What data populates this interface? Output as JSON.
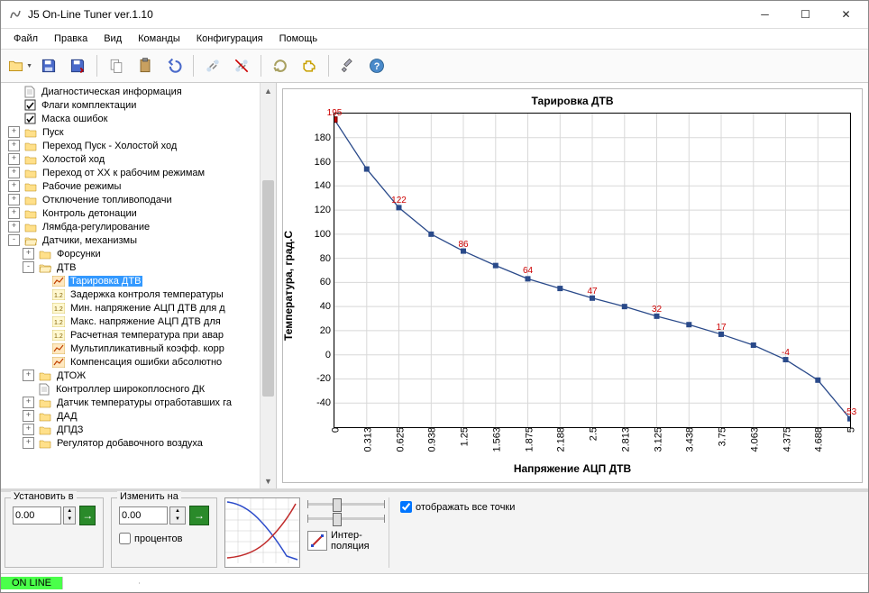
{
  "window": {
    "title": "J5 On-Line Tuner ver.1.10"
  },
  "menu": {
    "file": "Файл",
    "edit": "Правка",
    "view": "Вид",
    "commands": "Команды",
    "config": "Конфигурация",
    "help": "Помощь"
  },
  "tree": {
    "items": [
      {
        "d": 0,
        "exp": "",
        "ic": "page",
        "label": "Диагностическая информация"
      },
      {
        "d": 0,
        "exp": "",
        "ic": "check",
        "label": "Флаги комплектации"
      },
      {
        "d": 0,
        "exp": "",
        "ic": "check",
        "label": "Маска ошибок"
      },
      {
        "d": 0,
        "exp": "+",
        "ic": "folder",
        "label": "Пуск"
      },
      {
        "d": 0,
        "exp": "+",
        "ic": "folder",
        "label": "Переход Пуск - Холостой ход"
      },
      {
        "d": 0,
        "exp": "+",
        "ic": "folder",
        "label": "Холостой ход"
      },
      {
        "d": 0,
        "exp": "+",
        "ic": "folder",
        "label": "Переход от ХХ к рабочим режимам"
      },
      {
        "d": 0,
        "exp": "+",
        "ic": "folder",
        "label": "Рабочие режимы"
      },
      {
        "d": 0,
        "exp": "+",
        "ic": "folder",
        "label": "Отключение топливоподачи"
      },
      {
        "d": 0,
        "exp": "+",
        "ic": "folder",
        "label": "Контроль детонации"
      },
      {
        "d": 0,
        "exp": "+",
        "ic": "folder",
        "label": "Лямбда-регулирование"
      },
      {
        "d": 0,
        "exp": "-",
        "ic": "folderO",
        "label": "Датчики, механизмы"
      },
      {
        "d": 1,
        "exp": "+",
        "ic": "folder",
        "label": "Форсунки"
      },
      {
        "d": 1,
        "exp": "-",
        "ic": "folderO",
        "label": "ДТВ"
      },
      {
        "d": 2,
        "exp": "",
        "ic": "chart",
        "label": "Тарировка ДТВ",
        "sel": true
      },
      {
        "d": 2,
        "exp": "",
        "ic": "val",
        "label": "Задержка контроля температуры"
      },
      {
        "d": 2,
        "exp": "",
        "ic": "val",
        "label": "Мин. напряжение АЦП ДТВ для д"
      },
      {
        "d": 2,
        "exp": "",
        "ic": "val",
        "label": "Макс. напряжение АЦП ДТВ для "
      },
      {
        "d": 2,
        "exp": "",
        "ic": "val",
        "label": "Расчетная температура при авар"
      },
      {
        "d": 2,
        "exp": "",
        "ic": "chart",
        "label": "Мультипликативный коэфф. корр"
      },
      {
        "d": 2,
        "exp": "",
        "ic": "chart",
        "label": "Компенсация ошибки абсолютно"
      },
      {
        "d": 1,
        "exp": "+",
        "ic": "folder",
        "label": "ДТОЖ"
      },
      {
        "d": 1,
        "exp": "",
        "ic": "page",
        "label": "Контроллер широкоплосного ДК"
      },
      {
        "d": 1,
        "exp": "+",
        "ic": "folder",
        "label": "Датчик температуры отработавших га"
      },
      {
        "d": 1,
        "exp": "+",
        "ic": "folder",
        "label": "ДАД"
      },
      {
        "d": 1,
        "exp": "+",
        "ic": "folder",
        "label": "ДПДЗ"
      },
      {
        "d": 1,
        "exp": "+",
        "ic": "folder",
        "label": "Регулятор добавочного воздуха"
      }
    ]
  },
  "chart_data": {
    "type": "line",
    "title": "Тарировка ДТВ",
    "xlabel": "Напряжение АЦП ДТВ",
    "ylabel": "Температура, град.С",
    "x": [
      0,
      0.313,
      0.625,
      0.938,
      1.25,
      1.563,
      1.875,
      2.188,
      2.5,
      2.813,
      3.125,
      3.438,
      3.75,
      4.063,
      4.375,
      4.688,
      5
    ],
    "y": [
      195,
      154,
      122,
      100,
      86,
      74,
      63,
      55,
      47,
      40,
      32,
      25,
      17,
      8,
      -4,
      -21,
      -53
    ],
    "annotations": [
      {
        "x": 0,
        "y": 195,
        "text": "195"
      },
      {
        "x": 0.625,
        "y": 122,
        "text": "122"
      },
      {
        "x": 1.25,
        "y": 86,
        "text": "86"
      },
      {
        "x": 1.875,
        "y": 64,
        "text": "64"
      },
      {
        "x": 2.5,
        "y": 47,
        "text": "47"
      },
      {
        "x": 3.125,
        "y": 32,
        "text": "32"
      },
      {
        "x": 3.75,
        "y": 17,
        "text": "17"
      },
      {
        "x": 4.375,
        "y": -4,
        "text": "-4"
      },
      {
        "x": 5,
        "y": -53,
        "text": "-53"
      }
    ],
    "xlim": [
      0,
      5
    ],
    "ylim": [
      -60,
      200
    ],
    "yticks": [
      -40,
      -20,
      0,
      20,
      40,
      60,
      80,
      100,
      120,
      140,
      160,
      180
    ],
    "xticks": [
      0,
      0.313,
      0.625,
      0.938,
      1.25,
      1.563,
      1.875,
      2.188,
      2.5,
      2.813,
      3.125,
      3.438,
      3.75,
      4.063,
      4.375,
      4.688,
      5
    ],
    "selected_index": 0
  },
  "controls": {
    "set_caption": "Установить в",
    "set_value": "0.00",
    "change_caption": "Изменить на",
    "change_value": "0.00",
    "percent_label": "процентов",
    "interp_label": "Интер-\nполяция",
    "showall_label": "отображать все точки",
    "showall": true
  },
  "status": {
    "online": "ON LINE"
  }
}
